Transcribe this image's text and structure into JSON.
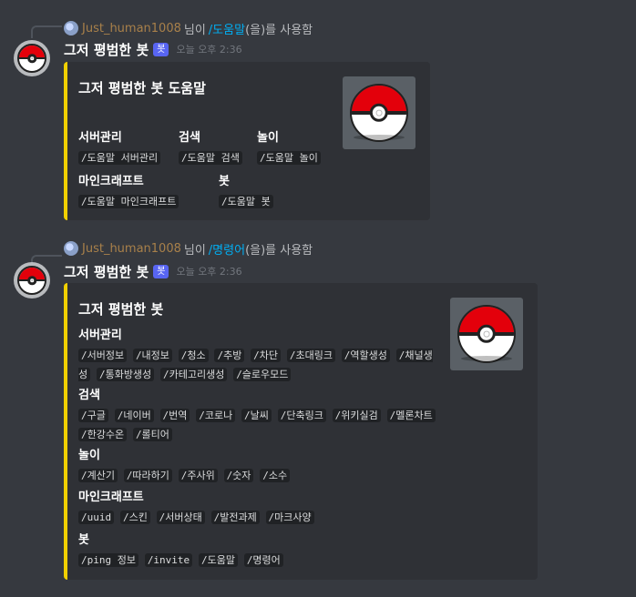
{
  "messages": [
    {
      "reply": {
        "user": "Just_human1008",
        "connector": "님이",
        "command": "/도움말",
        "suffix": "(을)를 사용함"
      },
      "author": {
        "name": "그저 평범한 봇",
        "tag": "봇",
        "time": "오늘 오후 2:36"
      },
      "embed": {
        "title": "그저 평범한 봇 도움말",
        "fields": [
          {
            "name": "서버관리",
            "values": [
              "/도움말 서버관리"
            ]
          },
          {
            "name": "검색",
            "values": [
              "/도움말 검색"
            ]
          },
          {
            "name": "놀이",
            "values": [
              "/도움말 놀이"
            ]
          },
          {
            "name": "마인크래프트",
            "values": [
              "/도움말 마인크래프트"
            ]
          },
          {
            "name": "봇",
            "values": [
              "/도움말 봇"
            ]
          }
        ]
      }
    },
    {
      "reply": {
        "user": "Just_human1008",
        "connector": "님이",
        "command": "/명령어",
        "suffix": "(을)를 사용함"
      },
      "author": {
        "name": "그저 평범한 봇",
        "tag": "봇",
        "time": "오늘 오후 2:36"
      },
      "embed": {
        "title": "그저 평범한 봇",
        "fields": [
          {
            "name": "서버관리",
            "values": [
              "/서버정보",
              "/내정보",
              "/청소",
              "/추방",
              "/차단",
              "/초대링크",
              "/역할생성",
              "/채널생성",
              "/통화방생성",
              "/카테고리생성",
              "/슬로우모드"
            ]
          },
          {
            "name": "검색",
            "values": [
              "/구글",
              "/네이버",
              "/번역",
              "/코로나",
              "/날씨",
              "/단축링크",
              "/위키실검",
              "/멜론차트",
              "/한강수온",
              "/롤티어"
            ]
          },
          {
            "name": "놀이",
            "values": [
              "/계산기",
              "/따라하기",
              "/주사위",
              "/숫자",
              "/소수"
            ]
          },
          {
            "name": "마인크래프트",
            "values": [
              "/uuid",
              "/스킨",
              "/서버상태",
              "/발전과제",
              "/마크사양"
            ]
          },
          {
            "name": "봇",
            "values": [
              "/ping 정보",
              "/invite",
              "/도움말",
              "/명령어"
            ]
          }
        ]
      }
    }
  ],
  "colors": {
    "background": "#36393f",
    "embed_bg": "#2f3136",
    "embed_accent": "#f1d000",
    "link": "#00aff4",
    "bot_tag": "#5865f2"
  },
  "icons": {
    "avatar": "pokeball-icon",
    "thumbnail": "pokeball-icon",
    "reply_avatar": "globe-avatar-icon"
  }
}
